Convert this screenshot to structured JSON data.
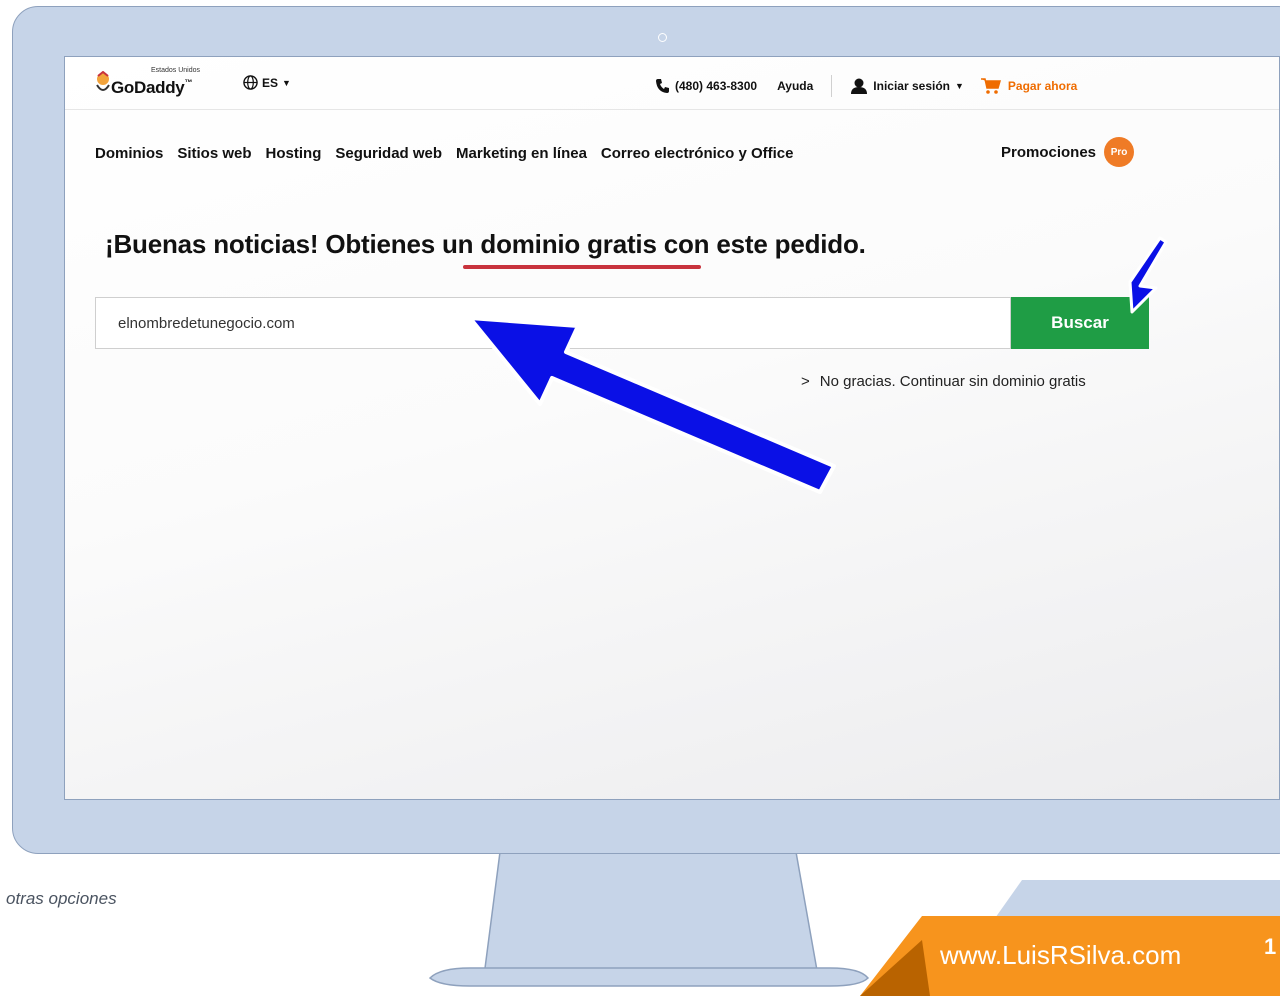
{
  "header": {
    "country": "Estados Unidos",
    "brand": "GoDaddy",
    "trademark": "™",
    "language": "ES",
    "phone": "(480) 463-8300",
    "help": "Ayuda",
    "signin": "Iniciar sesión",
    "checkout": "Pagar ahora"
  },
  "nav": {
    "items": [
      "Dominios",
      "Sitios web",
      "Hosting",
      "Seguridad web",
      "Marketing en línea",
      "Correo electrónico y Office"
    ],
    "promotions": "Promociones",
    "pro_badge": "Pro"
  },
  "main": {
    "headline": "¡Buenas noticias! Obtienes un dominio gratis con este pedido.",
    "search_value": "elnombredetunegocio.com",
    "search_button": "Buscar",
    "skip_chevron": ">",
    "skip_link": "No gracias. Continuar sin dominio gratis"
  },
  "slide": {
    "caption": "otras opciones",
    "url": "www.LuisRSilva.com",
    "page_number": "1"
  },
  "colors": {
    "monitor": "#c6d4e8",
    "search_button": "#1f9d45",
    "accent_orange": "#f7941d",
    "checkout": "#ef6c00",
    "arrow": "#0a10e6",
    "underline": "#c8333d"
  }
}
